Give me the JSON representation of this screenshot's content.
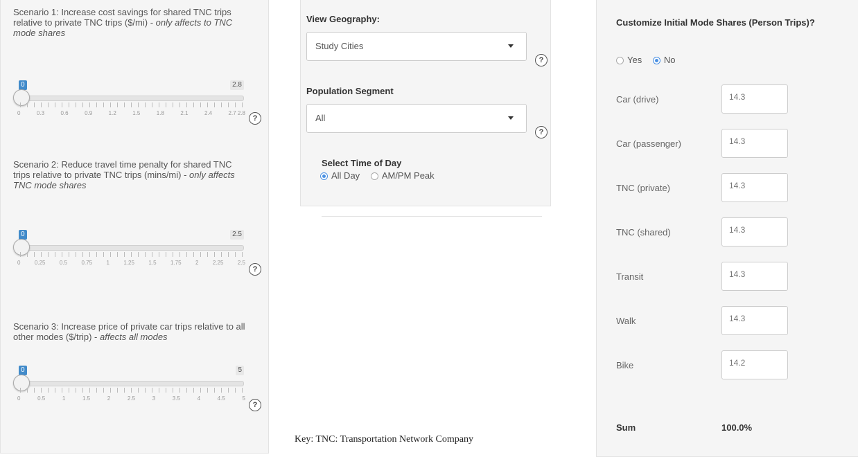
{
  "scenarios": [
    {
      "text": "Scenario 1: Increase cost savings for shared TNC trips relative to private TNC trips ($/mi) - ",
      "italic": "only affects to TNC mode shares",
      "min": "0",
      "max": "2.8",
      "ticks": [
        "0",
        "0.3",
        "0.6",
        "0.9",
        "1.2",
        "1.5",
        "1.8",
        "2.1",
        "2.4",
        "2.7 2.8"
      ]
    },
    {
      "text": "Scenario 2: Reduce travel time penalty for shared TNC trips relative to private TNC trips (mins/mi) - ",
      "italic": "only affects TNC mode shares",
      "min": "0",
      "max": "2.5",
      "ticks": [
        "0",
        "0.25",
        "0.5",
        "0.75",
        "1",
        "1.25",
        "1.5",
        "1.75",
        "2",
        "2.25",
        "2.5"
      ]
    },
    {
      "text": "Scenario 3: Increase price of private car trips relative to all other modes ($/trip) - ",
      "italic": "affects all modes",
      "min": "0",
      "max": "5",
      "ticks": [
        "0",
        "0.5",
        "1",
        "1.5",
        "2",
        "2.5",
        "3",
        "3.5",
        "4",
        "4.5",
        "5"
      ]
    }
  ],
  "help_symbol": "?",
  "geography": {
    "label": "View Geography:",
    "value": "Study Cities"
  },
  "population": {
    "label": "Population Segment",
    "value": "All"
  },
  "time_of_day": {
    "label": "Select Time of Day",
    "options": [
      "All Day",
      "AM/PM Peak"
    ],
    "selected": "All Day"
  },
  "customize": {
    "label": "Customize Initial Mode Shares (Person Trips)?",
    "options": [
      "Yes",
      "No"
    ],
    "selected": "No"
  },
  "modes": [
    {
      "label": "Car (drive)",
      "value": "14.3"
    },
    {
      "label": "Car (passenger)",
      "value": "14.3"
    },
    {
      "label": "TNC (private)",
      "value": "14.3"
    },
    {
      "label": "TNC (shared)",
      "value": "14.3"
    },
    {
      "label": "Transit",
      "value": "14.3"
    },
    {
      "label": "Walk",
      "value": "14.3"
    },
    {
      "label": "Bike",
      "value": "14.2"
    }
  ],
  "sum": {
    "label": "Sum",
    "value": "100.0%"
  },
  "key_note": "Key: TNC: Transportation Network Company",
  "colors": {
    "accent": "#428bca",
    "panel_bg": "#f5f5f5"
  }
}
